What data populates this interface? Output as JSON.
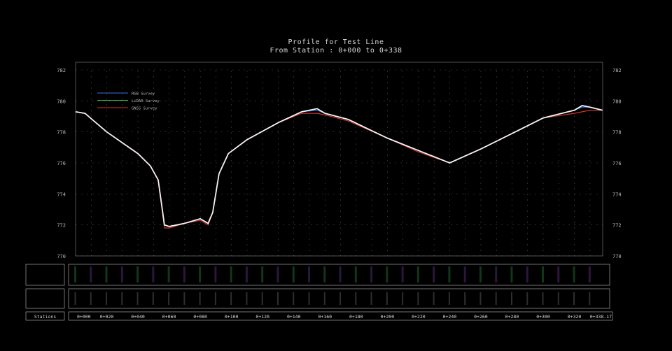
{
  "header": {
    "title": "Profile for  Test Line",
    "subtitle": "From Station : 0+000 to 0+338"
  },
  "bottom": {
    "stations_label": "Stations"
  },
  "colors": {
    "background": "#000000",
    "rgb_survey": "#3a6fd8",
    "lidar_survey": "#2fb84a",
    "gnss_survey": "#d03030",
    "main_line": "#ffffff",
    "grid": "#4a4a4a",
    "frame": "#bdbdbd",
    "band_text_green": "#2f9e47",
    "band_text_purple": "#7a3fb0"
  },
  "chart_data": {
    "type": "line",
    "title": "Profile for  Test Line",
    "subtitle": "From Station : 0+000 to 0+338",
    "xlabel": "",
    "ylabel": "",
    "xlim": [
      0,
      338.17
    ],
    "ylim": [
      770,
      782
    ],
    "yticks": [
      770,
      772,
      774,
      776,
      778,
      780,
      782
    ],
    "xticks": [
      0,
      20,
      40,
      60,
      80,
      100,
      120,
      140,
      160,
      180,
      200,
      220,
      240,
      260,
      280,
      300,
      320,
      338.17
    ],
    "xtick_labels": [
      "0+000",
      "0+020",
      "0+040",
      "0+060",
      "0+080",
      "0+100",
      "0+120",
      "0+140",
      "0+160",
      "0+180",
      "0+200",
      "0+220",
      "0+240",
      "0+260",
      "0+280",
      "0+300",
      "0+320",
      "0+338.17"
    ],
    "grid": true,
    "legend_position": "top-left",
    "x": [
      0,
      6,
      20,
      40,
      48,
      53,
      57,
      60,
      70,
      80,
      85,
      88,
      92,
      98,
      110,
      130,
      145,
      155,
      160,
      175,
      200,
      220,
      240,
      260,
      280,
      300,
      320,
      325,
      330,
      338
    ],
    "series": [
      {
        "name": "RGB Survey",
        "values": [
          779.3,
          779.2,
          778.0,
          776.6,
          775.8,
          774.9,
          772.0,
          771.9,
          772.1,
          772.4,
          772.1,
          772.8,
          775.3,
          776.6,
          777.5,
          778.6,
          779.3,
          779.4,
          779.2,
          778.8,
          777.6,
          776.8,
          776.0,
          776.9,
          777.9,
          778.9,
          779.4,
          779.6,
          779.6,
          779.4
        ]
      },
      {
        "name": "LiDAR Survey",
        "values": [
          779.3,
          779.2,
          778.0,
          776.6,
          775.8,
          774.9,
          772.0,
          771.9,
          772.1,
          772.4,
          772.1,
          772.8,
          775.3,
          776.6,
          777.5,
          778.6,
          779.3,
          779.5,
          779.2,
          778.8,
          777.6,
          776.8,
          776.0,
          776.9,
          777.9,
          778.9,
          779.4,
          779.7,
          779.6,
          779.4
        ]
      },
      {
        "name": "GNSS Survey",
        "values": [
          779.3,
          779.2,
          778.0,
          776.6,
          775.8,
          774.9,
          771.8,
          771.8,
          772.1,
          772.3,
          772.0,
          772.8,
          775.3,
          776.6,
          777.5,
          778.6,
          779.2,
          779.2,
          779.1,
          778.7,
          777.6,
          776.7,
          776.0,
          776.9,
          777.9,
          778.9,
          779.2,
          779.3,
          779.4,
          779.4
        ]
      }
    ]
  }
}
